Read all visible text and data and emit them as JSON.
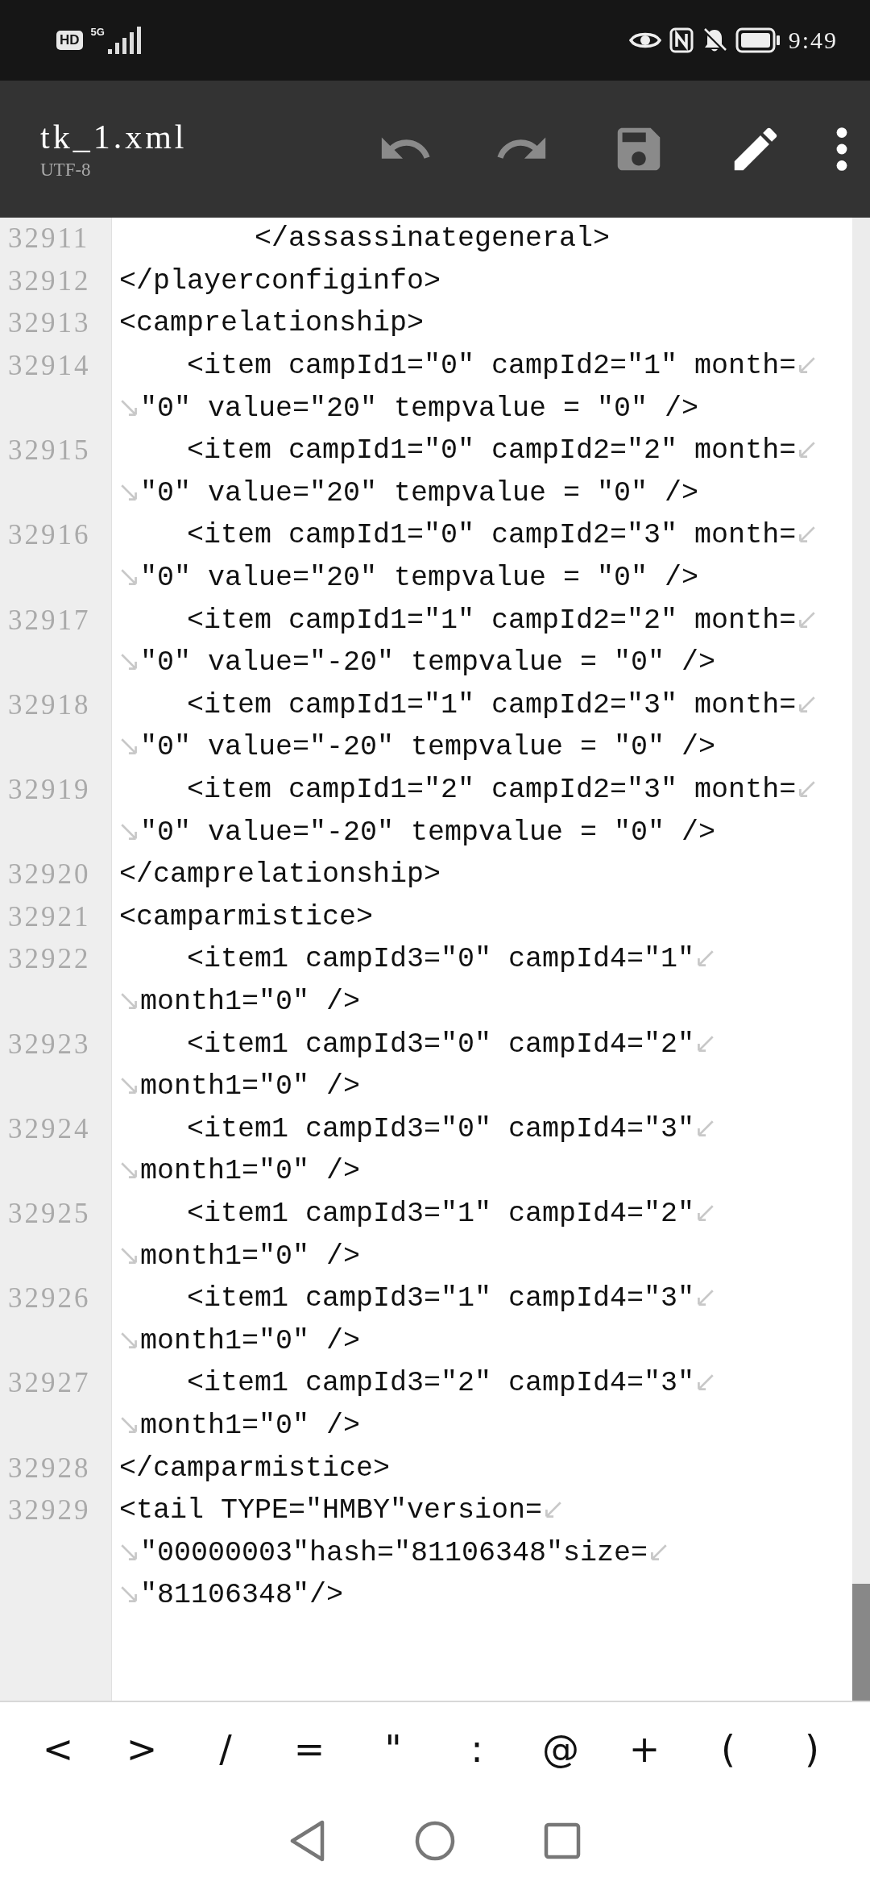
{
  "status_bar": {
    "badge": "HD",
    "network": "5G",
    "time": "9:49"
  },
  "toolbar": {
    "title": "tk_1.xml",
    "encoding": "UTF-8",
    "actions": [
      {
        "kind": "undo",
        "disabled": true
      },
      {
        "kind": "redo",
        "disabled": true
      },
      {
        "kind": "save",
        "disabled": true
      },
      {
        "kind": "edit",
        "disabled": false
      },
      {
        "kind": "more",
        "disabled": false
      }
    ]
  },
  "editor": {
    "lines": [
      {
        "number": "32911",
        "segments": [
          "        </assassinategeneral>"
        ]
      },
      {
        "number": "32912",
        "segments": [
          "</playerconfiginfo>"
        ]
      },
      {
        "number": "32913",
        "segments": [
          "<camprelationship>"
        ]
      },
      {
        "number": "32914",
        "segments": [
          "    <item campId1=\"0\" campId2=\"1\" month=",
          "\"0\" value=\"20\" tempvalue = \"0\" />"
        ]
      },
      {
        "number": "32915",
        "segments": [
          "    <item campId1=\"0\" campId2=\"2\" month=",
          "\"0\" value=\"20\" tempvalue = \"0\" />"
        ]
      },
      {
        "number": "32916",
        "segments": [
          "    <item campId1=\"0\" campId2=\"3\" month=",
          "\"0\" value=\"20\" tempvalue = \"0\" />"
        ]
      },
      {
        "number": "32917",
        "segments": [
          "    <item campId1=\"1\" campId2=\"2\" month=",
          "\"0\" value=\"-20\" tempvalue = \"0\" />"
        ]
      },
      {
        "number": "32918",
        "segments": [
          "    <item campId1=\"1\" campId2=\"3\" month=",
          "\"0\" value=\"-20\" tempvalue = \"0\" />"
        ]
      },
      {
        "number": "32919",
        "segments": [
          "    <item campId1=\"2\" campId2=\"3\" month=",
          "\"0\" value=\"-20\" tempvalue = \"0\" />"
        ]
      },
      {
        "number": "32920",
        "segments": [
          "</camprelationship>"
        ]
      },
      {
        "number": "32921",
        "segments": [
          "<camparmistice>"
        ]
      },
      {
        "number": "32922",
        "segments": [
          "    <item1 campId3=\"0\" campId4=\"1\"",
          "month1=\"0\" />"
        ]
      },
      {
        "number": "32923",
        "segments": [
          "    <item1 campId3=\"0\" campId4=\"2\"",
          "month1=\"0\" />"
        ]
      },
      {
        "number": "32924",
        "segments": [
          "    <item1 campId3=\"0\" campId4=\"3\"",
          "month1=\"0\" />"
        ]
      },
      {
        "number": "32925",
        "segments": [
          "    <item1 campId3=\"1\" campId4=\"2\"",
          "month1=\"0\" />"
        ]
      },
      {
        "number": "32926",
        "segments": [
          "    <item1 campId3=\"1\" campId4=\"3\"",
          "month1=\"0\" />"
        ]
      },
      {
        "number": "32927",
        "segments": [
          "    <item1 campId3=\"2\" campId4=\"3\"",
          "month1=\"0\" />"
        ]
      },
      {
        "number": "32928",
        "segments": [
          "</camparmistice>"
        ]
      },
      {
        "number": "32929",
        "segments": [
          "<tail TYPE=\"HMBY\"version=",
          "\"00000003\"hash=\"81106348\"size=",
          "\"81106348\"/>"
        ]
      }
    ]
  },
  "symbol_keys": [
    "<",
    ">",
    "/",
    "=",
    "\"",
    ":",
    "@",
    "+",
    "(",
    ")"
  ]
}
